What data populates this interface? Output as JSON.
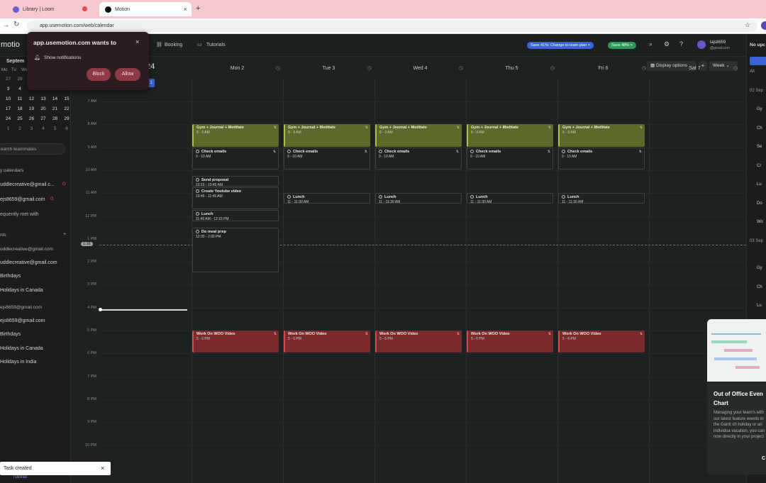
{
  "browser": {
    "tabs": [
      {
        "label": "Library | Loom",
        "color": "#6b5bd6"
      },
      {
        "label": "Motion",
        "color": "#111"
      }
    ],
    "url": "app.usemotion.com/web/calendar",
    "new_tab": "+"
  },
  "notification": {
    "title": "app.usemotion.com wants to",
    "item": "Show notifications",
    "block": "Block",
    "allow": "Allow",
    "close": "×"
  },
  "topnav": {
    "brand": "motio",
    "booking": "Booking",
    "tutorials": "Tutorials",
    "promo1": "Save 41%: Change to team plan ×",
    "promo2": "Save 48% ×",
    "user": "lajs8659",
    "email": "@gmail.com",
    "right_label": "No upc",
    "display_options": "Display options",
    "add": "+",
    "week": "Week",
    "year_frag": "24"
  },
  "sidebar": {
    "month": "Septem",
    "weekday_labels": [
      "Mo",
      "Tu",
      "We"
    ],
    "weeks": [
      [
        "26",
        "27",
        "28",
        "29",
        "30",
        "31",
        "1"
      ],
      [
        "2",
        "3",
        "4",
        "5",
        "6",
        "7",
        "8"
      ],
      [
        "9",
        "10",
        "11",
        "12",
        "13",
        "14",
        "15"
      ],
      [
        "16",
        "17",
        "18",
        "19",
        "20",
        "21",
        "22"
      ],
      [
        "23",
        "24",
        "25",
        "26",
        "27",
        "28",
        "29"
      ],
      [
        "30",
        "1",
        "2",
        "3",
        "4",
        "5",
        "6"
      ]
    ],
    "search": "earch teammates",
    "my_calendars": "y calendars",
    "cal1": "uddlecreative@gmail.c...",
    "cal2": "ejs8659@gmail.com",
    "freq": "equently met with",
    "events": "nts",
    "add": "+",
    "acc1": "uddlecreative@gmail.com",
    "acc1b": "uddlecreative@gmail.com",
    "birthdays1": "Birthdays",
    "hol_canada1": "Holidays in Canada",
    "acc2": "ejs8659@gmail.com",
    "acc2b": "ejs8659@gmail.com",
    "birthdays2": "Birthdays",
    "hol_canada2": "Holidays in Canada",
    "hol_india": "Holidays in India",
    "tutorial": "Tutorial"
  },
  "calendar": {
    "days": [
      {
        "label": "Mon 2"
      },
      {
        "label": "Tue 3"
      },
      {
        "label": "Wed 4"
      },
      {
        "label": "Thu 5"
      },
      {
        "label": "Fri 6"
      },
      {
        "label": "Sat 7"
      }
    ],
    "first_col_badge": "1",
    "hours": [
      "7 AM",
      "8 AM",
      "9 AM",
      "10 AM",
      "11 AM",
      "12 PM",
      "1 PM",
      "2 PM",
      "3 PM",
      "4 PM",
      "5 PM",
      "6 PM",
      "7 PM",
      "8 PM",
      "9 PM",
      "10 PM"
    ],
    "now_time": "1:16",
    "gym_title": "Gym + Journal + Meditate",
    "gym_time": "8 - 9 AM",
    "check_title": "Check emails",
    "check_time_mon": "9 - 10 AM",
    "check_time": "9 - 10 AM",
    "send_title": "Send proposal",
    "send_time": "10:15 - 10:45 AM",
    "yt_title": "Create Youtube video",
    "yt_time": "10:45 - 11:45 AM",
    "lunch_title": "Lunch",
    "lunch_time_mon": "11:45 AM - 12:15 PM",
    "lunch_time": "11 - 11:30 AM",
    "meal_title": "Do meal prep",
    "meal_time": "12:30 - 2:30 PM",
    "woo_title": "Work On WOO Video",
    "woo_time": "5 - 6 PM"
  },
  "right": {
    "items": [
      "All",
      "02 Sep",
      "Gy",
      "Ch",
      "Se",
      "Cr",
      "Lu",
      "Do",
      "Wo",
      "03 Sep",
      "Gy",
      "Ch",
      "Lu",
      "Wo"
    ]
  },
  "popup": {
    "title": "Out of Office Even Chart",
    "body": "Managing your team's with our latest feature events in the Gantt ch holiday or an individua vacation, you can now directly in your project",
    "cta": "C"
  },
  "toast": {
    "text": "Task created",
    "close": "×"
  },
  "colors": {
    "gym": "#5b6a28",
    "woo": "#7a2a2a",
    "accent": "#3a63d6"
  }
}
